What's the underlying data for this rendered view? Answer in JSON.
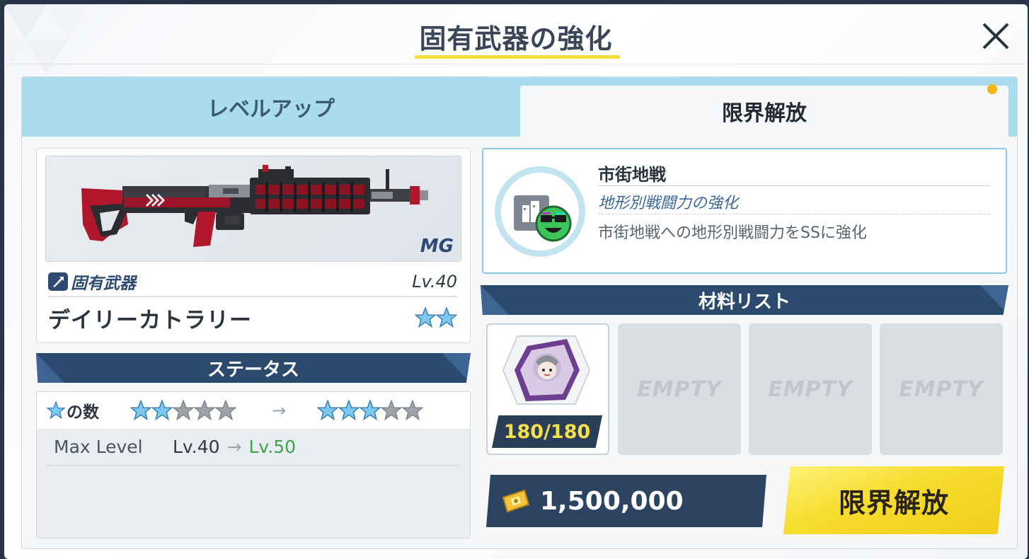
{
  "modal": {
    "title": "固有武器の強化"
  },
  "tabs": [
    {
      "label": "レベルアップ",
      "active": false
    },
    {
      "label": "限界解放",
      "active": true
    }
  ],
  "weapon": {
    "type": "MG",
    "kind_label": "固有武器",
    "level": "Lv.40",
    "name": "デイリーカトラリー",
    "stars": 2
  },
  "status": {
    "header": "ステータス",
    "star_count_label": "の数",
    "stars_before": {
      "filled": 2,
      "total": 5
    },
    "stars_after": {
      "filled": 3,
      "total": 5
    },
    "arrow": "→",
    "max_level_label": "Max Level",
    "max_level_from": "Lv.40",
    "max_level_arrow": "→",
    "max_level_to": "Lv.50"
  },
  "skill": {
    "title": "市街地戦",
    "subtitle": "地形別戦闘力の強化",
    "description": "市街地戦への地形別戦闘力をSSに強化"
  },
  "materials": {
    "header": "材料リスト",
    "slots": [
      {
        "filled": true,
        "count": "180/180"
      },
      {
        "filled": false,
        "label": "EMPTY"
      },
      {
        "filled": false,
        "label": "EMPTY"
      },
      {
        "filled": false,
        "label": "EMPTY"
      }
    ]
  },
  "cost": {
    "amount": "1,500,000"
  },
  "action": {
    "button_label": "限界解放"
  },
  "colors": {
    "accent_yellow": "#f6dc2c",
    "header_navy": "#2b4a6e",
    "tab_blue": "#a9dcef",
    "star_blue": "#7cc8ee",
    "level_green": "#3aa64a"
  }
}
